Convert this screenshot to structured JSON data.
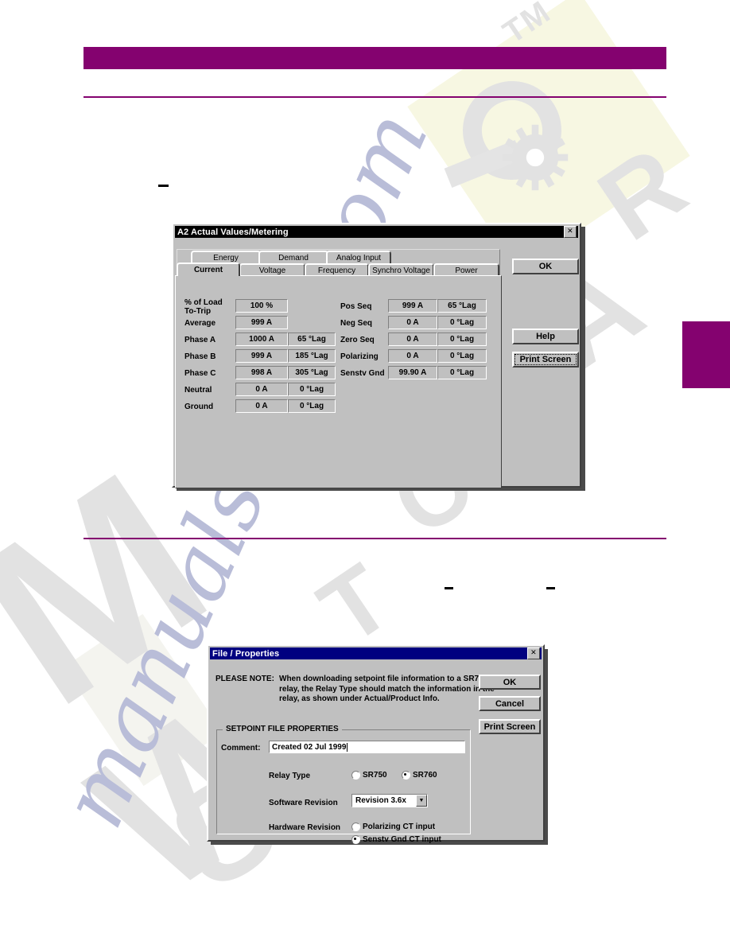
{
  "page": {
    "header_bar_color": "#84026f",
    "rule_color": "#84026f",
    "side_tab_color": "#84026f",
    "background": "#ffffff"
  },
  "watermark": {
    "script_text": "manualshive.com",
    "letters": [
      "M",
      "A",
      "T",
      "C",
      "H",
      "O",
      "R",
      "W",
      "S"
    ],
    "tm_text": "TM",
    "logo": "gear-and-ring-logo",
    "accent_color": "#f7f7e2",
    "gray_color": "#e2e2e2",
    "script_color": "#b9bdd8"
  },
  "dialog1": {
    "title": "A2 Actual Values/Metering",
    "close_label": "✕",
    "titlebar_color": "#000000",
    "tabs_row1": [
      {
        "label": "Energy",
        "selected": false
      },
      {
        "label": "Demand",
        "selected": false
      },
      {
        "label": "Analog Input",
        "selected": false
      }
    ],
    "tabs_row2": [
      {
        "label": "Current",
        "selected": true
      },
      {
        "label": "Voltage",
        "selected": false
      },
      {
        "label": "Frequency",
        "selected": false
      },
      {
        "label": "Synchro Voltage",
        "selected": false
      },
      {
        "label": "Power",
        "selected": false
      }
    ],
    "left_rows": [
      {
        "label_line1": "% of Load",
        "label_line2": "To-Trip",
        "value": "100 %",
        "angle": ""
      },
      {
        "label_line1": "Average",
        "label_line2": "",
        "value": "999 A",
        "angle": ""
      },
      {
        "label_line1": "Phase A",
        "label_line2": "",
        "value": "1000 A",
        "angle": "65 °Lag"
      },
      {
        "label_line1": "Phase B",
        "label_line2": "",
        "value": "999 A",
        "angle": "185 °Lag"
      },
      {
        "label_line1": "Phase C",
        "label_line2": "",
        "value": "998 A",
        "angle": "305 °Lag"
      },
      {
        "label_line1": "Neutral",
        "label_line2": "",
        "value": "0 A",
        "angle": "0 °Lag"
      },
      {
        "label_line1": "Ground",
        "label_line2": "",
        "value": "0 A",
        "angle": "0 °Lag"
      }
    ],
    "right_rows": [
      {
        "label": "Pos Seq",
        "value": "999 A",
        "angle": "65 °Lag"
      },
      {
        "label": "Neg Seq",
        "value": "0 A",
        "angle": "0 °Lag"
      },
      {
        "label": "Zero Seq",
        "value": "0 A",
        "angle": "0 °Lag"
      },
      {
        "label": "Polarizing",
        "value": "0 A",
        "angle": "0 °Lag"
      },
      {
        "label": "Senstv Gnd",
        "value": "99.90 A",
        "angle": "0 °Lag"
      }
    ],
    "buttons": {
      "ok": "OK",
      "help": "Help",
      "print_screen": "Print Screen"
    }
  },
  "dialog2": {
    "title": "File / Properties",
    "close_label": "✕",
    "titlebar_color": "#000080",
    "note_label": "PLEASE NOTE:",
    "note_line1": "When downloading setpoint file information to a SR750",
    "note_line2": "relay, the Relay Type should match the information in the",
    "note_line3": "relay, as shown under Actual/Product Info.",
    "group_caption": "SETPOINT FILE PROPERTIES",
    "comment_label": "Comment:",
    "comment_value": "Created 02 Jul 1999",
    "relay_type_label": "Relay Type",
    "relay_type_options": [
      {
        "label": "SR750",
        "selected": false
      },
      {
        "label": "SR760",
        "selected": true
      }
    ],
    "software_revision_label": "Software Revision",
    "software_revision_value": "Revision 3.6x",
    "software_revision_arrow": "▼",
    "hardware_revision_label": "Hardware Revision",
    "hardware_revision_options": [
      {
        "label": "Polarizing CT input",
        "selected": false
      },
      {
        "label": "Senstv Gnd CT input",
        "selected": true
      }
    ],
    "buttons": {
      "ok": "OK",
      "cancel": "Cancel",
      "print_screen": "Print Screen"
    }
  }
}
